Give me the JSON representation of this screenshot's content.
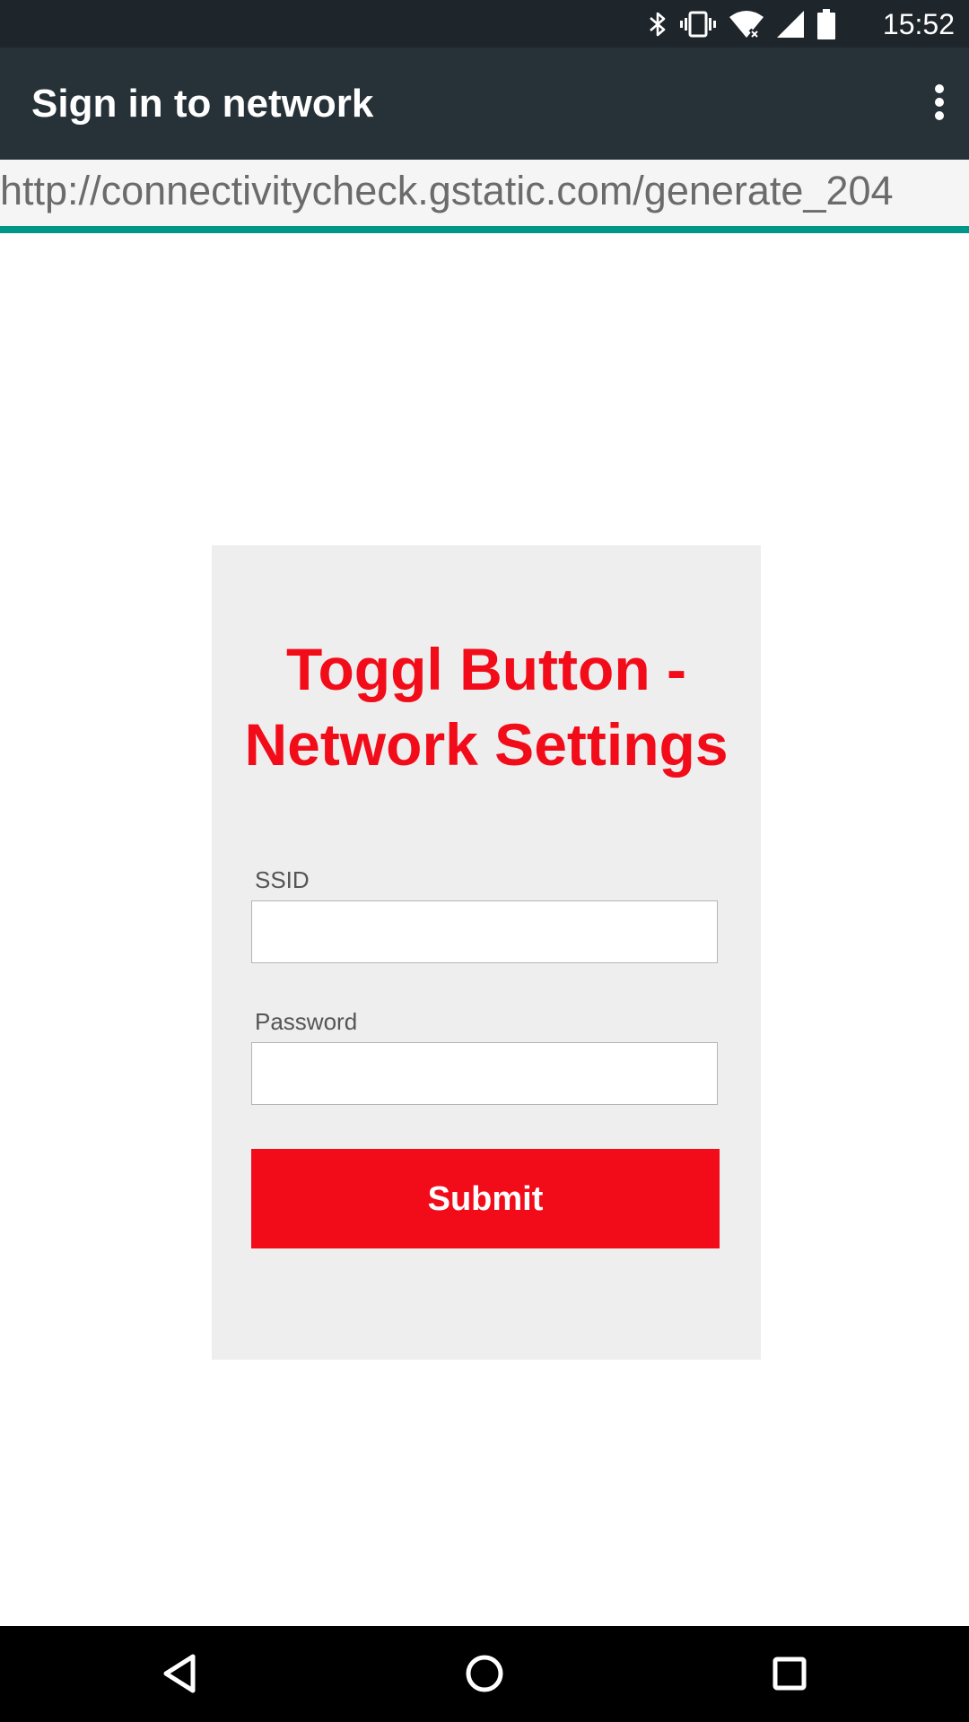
{
  "status_bar": {
    "time": "15:52",
    "icons": [
      "bluetooth-icon",
      "vibrate-icon",
      "wifi-icon",
      "cell-signal-icon",
      "battery-icon"
    ]
  },
  "app_bar": {
    "title": "Sign in to network",
    "overflow_icon": "more-vert-icon"
  },
  "url_bar": {
    "url": "http://connectivitycheck.gstatic.com/generate_204"
  },
  "page_load": {
    "progress_percent": 100,
    "color": "#009688"
  },
  "form": {
    "title": "Toggl Button - Network Settings",
    "ssid_label": "SSID",
    "ssid_value": "",
    "password_label": "Password",
    "password_value": "",
    "submit_label": "Submit",
    "accent_color": "#f20c19"
  },
  "nav_bar": {
    "icons": [
      "back-icon",
      "home-icon",
      "recents-icon"
    ]
  },
  "colors": {
    "status_bar": "#1e252b",
    "app_bar": "#263238",
    "card": "#eeeeee"
  }
}
